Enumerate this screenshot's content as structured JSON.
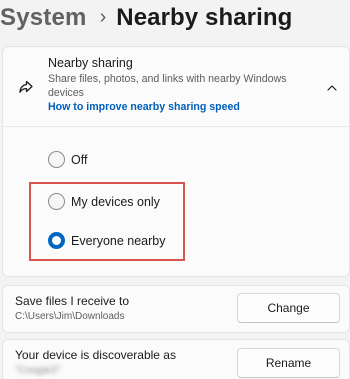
{
  "breadcrumb": {
    "parent": "System",
    "separator": "›",
    "current": "Nearby sharing"
  },
  "nearby_card": {
    "title": "Nearby sharing",
    "description": "Share files, photos, and links with nearby Windows devices",
    "link": "How to improve nearby sharing speed",
    "icon": "share-icon",
    "expanded": true
  },
  "radio_options": [
    {
      "label": "Off",
      "selected": false
    },
    {
      "label": "My devices only",
      "selected": false
    },
    {
      "label": "Everyone nearby",
      "selected": true
    }
  ],
  "save_row": {
    "title": "Save files I receive to",
    "path": "C:\\Users\\Jim\\Downloads",
    "button": "Change"
  },
  "discover_row": {
    "title": "Your device is discoverable as",
    "device_name": "\"Cougar2\"",
    "button": "Rename"
  },
  "colors": {
    "accent": "#0067c0",
    "link": "#005fb8",
    "highlight": "#d9534f"
  }
}
